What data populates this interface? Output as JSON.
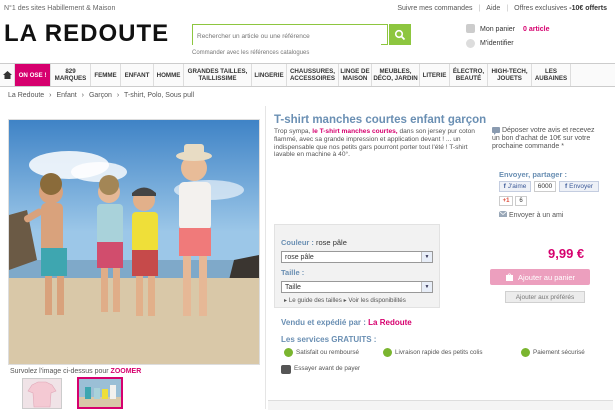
{
  "header": {
    "tagline": "N°1 des sites Habillement & Maison",
    "links": [
      "Suivre mes commandes",
      "Aide",
      "Offres exclusives"
    ],
    "offer_bold": "-10€ offerts",
    "logo": "LA REDOUTE",
    "search_placeholder": "Rechercher un article ou une référence",
    "search_hint": "Commander avec les références catalogues",
    "cart_label": "Mon panier",
    "cart_count": "0 article",
    "login_label": "M'identifier"
  },
  "nav": [
    "ON OSE !",
    "829 MARQUES",
    "FEMME",
    "ENFANT",
    "HOMME",
    "GRANDES TAILLES, TAILLISSIME",
    "LINGERIE",
    "CHAUSSURES, ACCESSOIRES",
    "LINGE DE MAISON",
    "MEUBLES, DÉCO, JARDIN",
    "LITERIE",
    "ÉLECTRO, BEAUTÉ",
    "HIGH-TECH, JOUETS",
    "LES AUBAINES"
  ],
  "breadcrumb": [
    "La Redoute",
    "›",
    "Enfant",
    "›",
    "Garçon",
    "›",
    "T-shirt, Polo, Sous pull"
  ],
  "product": {
    "title": "T-shirt manches courtes enfant garçon",
    "desc_1": "Trop sympa, ",
    "desc_hl": "le T-shirt manches courtes,",
    "desc_2": " dans son jersey pur coton flammé, avec sa grande impression et application devant ! ... un indispensable que nos petits gars pourront porter tout l'été ! T-shirt lavable en machine à 40°.",
    "zoom_text": "Survolez l'image ci-dessus pour ",
    "zoom_bold": "ZOOMER",
    "color_label": "Couleur :",
    "color_value": "rose pâle",
    "size_label": "Taille :",
    "size_value": "Taille",
    "size_guide": "Le guide des tailles",
    "availability": "Voir les disponibilités",
    "price": "9,99 €",
    "add_to_cart": "Ajouter au panier",
    "add_to_prefs": "Ajouter aux préférés",
    "sold_by_label": "Vendu et expédié par :",
    "sold_by_name": "La Redoute",
    "services_title": "Les services GRATUITS :",
    "services": [
      "Satisfait ou remboursé",
      "Livraison rapide des petits colis",
      "Paiement sécurisé",
      "Essayer avant de payer"
    ]
  },
  "side": {
    "review": "Déposer votre avis et recevez un bon d'achat de 10€ sur votre prochaine commande *",
    "share_label": "Envoyer, partager :",
    "fb_like": "J'aime",
    "fb_count": "6000",
    "fb_send": "Envoyer",
    "gplus": "+1",
    "gplus_count": "6",
    "send_friend": "Envoyer à un ami"
  },
  "colors": {
    "accent": "#d6006e",
    "title_blue": "#6a8fb3",
    "green": "#8dc63f"
  }
}
